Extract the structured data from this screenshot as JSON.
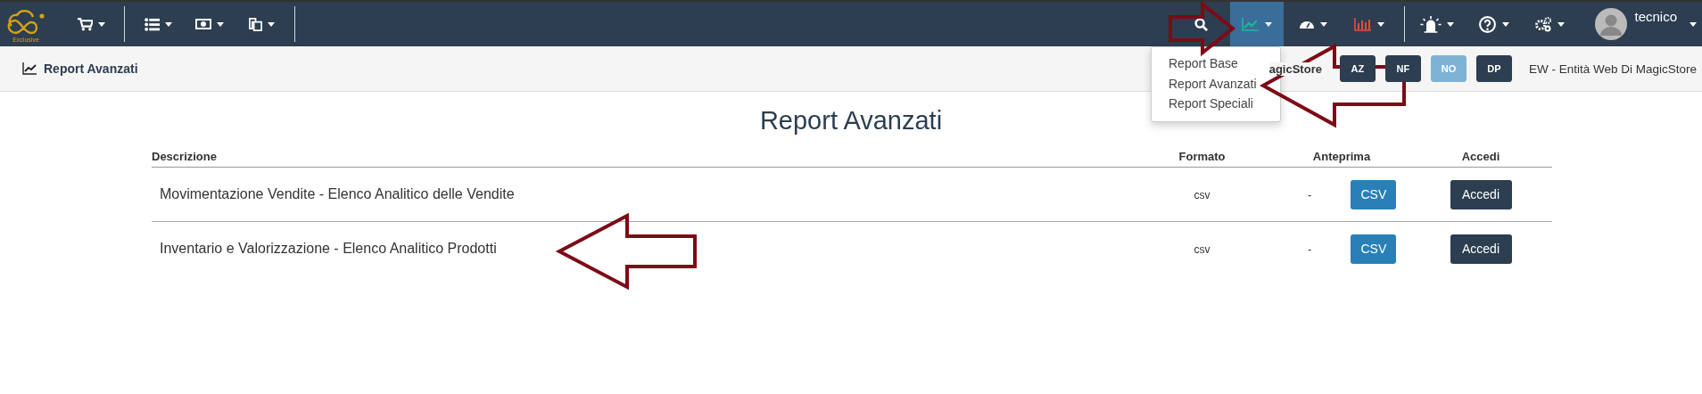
{
  "navbar": {
    "logo_text": "Exclusive",
    "left_items": [
      {
        "selected": false
      },
      {
        "selected": false
      },
      {
        "selected": false
      },
      {
        "selected": false
      }
    ],
    "right_items": [
      {
        "selected": false,
        "caret": false
      },
      {
        "selected": true,
        "caret": true
      },
      {
        "selected": false,
        "caret": true
      },
      {
        "selected": false,
        "caret": true
      },
      {
        "selected": false,
        "caret": true
      },
      {
        "selected": false,
        "caret": true
      },
      {
        "selected": false,
        "caret": true
      }
    ],
    "user": {
      "name": "tecnico"
    }
  },
  "dropdown": {
    "items": [
      {
        "label": "Report Base"
      },
      {
        "label": "Report Avanzati"
      },
      {
        "label": "Report Speciali"
      }
    ]
  },
  "subheader": {
    "title": "Report Avanzati",
    "store_fragment": "agicStore",
    "buttons": [
      {
        "label": "AZ",
        "selected": false
      },
      {
        "label": "NF",
        "selected": false
      },
      {
        "label": "NO",
        "selected": true
      },
      {
        "label": "DP",
        "selected": false
      }
    ],
    "entity": "EW - Entità Web Di MagicStore"
  },
  "page_title": "Report Avanzati",
  "table": {
    "columns": [
      "Descrizione",
      "Formato",
      "Anteprima",
      "Accedi"
    ],
    "rows": [
      {
        "description": "Movimentazione Vendite - Elenco Analitico delle Vendite",
        "format": "csv",
        "preview": "-",
        "preview_button": "CSV",
        "access_button": "Accedi"
      },
      {
        "description": "Inventario e Valorizzazione - Elenco Analitico Prodotti",
        "format": "csv",
        "preview": "-",
        "preview_button": "CSV",
        "access_button": "Accedi"
      }
    ]
  },
  "annotations": [
    {
      "kind": "arrow"
    },
    {
      "kind": "arrow"
    },
    {
      "kind": "arrow"
    }
  ]
}
